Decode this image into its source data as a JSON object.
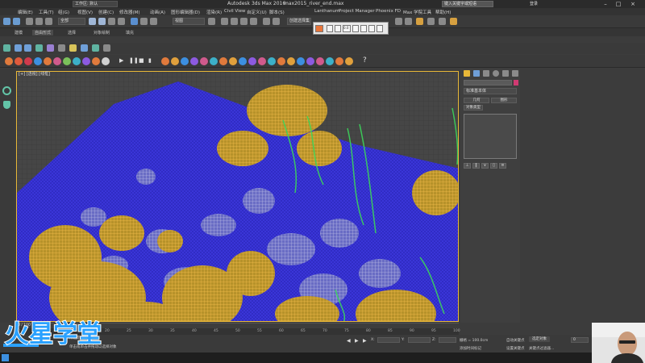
{
  "titlebar": {
    "app_title": "Autodesk 3ds Max 2016",
    "file_name": "max2015_river_end.max",
    "workspace": "工作区: 默认",
    "search_placeholder": "键入关键字或短语",
    "login": "登录"
  },
  "menu": {
    "items": [
      "编辑(E)",
      "工具(T)",
      "组(G)",
      "视图(V)",
      "创建(C)",
      "修改器(M)",
      "动画(A)",
      "图形编辑器(D)",
      "渲染(R)",
      "Civil View",
      "自定义(U)",
      "脚本(S)",
      "Lanthanum",
      "Project Manager",
      "Phoenix FD",
      "Max 学院工具",
      "帮助(H)"
    ]
  },
  "toolbar": {
    "filter_select": "全部",
    "view_select": "视图",
    "selection_set": "创建选择集"
  },
  "ribbon": {
    "tabs": [
      "建模",
      "自由形式",
      "选择",
      "对象绘制",
      "填充"
    ]
  },
  "floating_toolbar": {
    "value": "0.0"
  },
  "viewport": {
    "label": "[+] [透视] [线框]",
    "accent_color": "#e8b838"
  },
  "command_panel": {
    "name_value": "",
    "color_swatch": "#d03a72",
    "dropdown": "标准基本体",
    "btn_object_type": "对象类型",
    "btn_auto_grid": "自动栅格",
    "btn_name_color": "名称和颜色",
    "btn_geo": "几何",
    "btn_shape": "图形"
  },
  "timeline": {
    "ticks": [
      "0",
      "5",
      "10",
      "15",
      "20",
      "25",
      "30",
      "35",
      "40",
      "45",
      "50",
      "55",
      "60",
      "65",
      "70",
      "75",
      "80",
      "85",
      "90",
      "95",
      "100"
    ],
    "frame_counter": "0 / 100"
  },
  "statusbar": {
    "selected": "未选定任何对象",
    "prompt": "单击或单击并拖动以选择对象",
    "x_label": "X:",
    "x_val": "",
    "y_label": "Y:",
    "y_val": "",
    "z_label": "Z:",
    "z_val": "",
    "grid": "栅格 = 100.0cm",
    "auto_key": "自动关键点",
    "set_key": "设置关键点",
    "selected_obj": "选定对象",
    "key_filter": "关键点过滤器...",
    "add_time_tag": "添加时间标记",
    "frame_input": "0"
  },
  "logo": {
    "text": "火星学堂"
  }
}
